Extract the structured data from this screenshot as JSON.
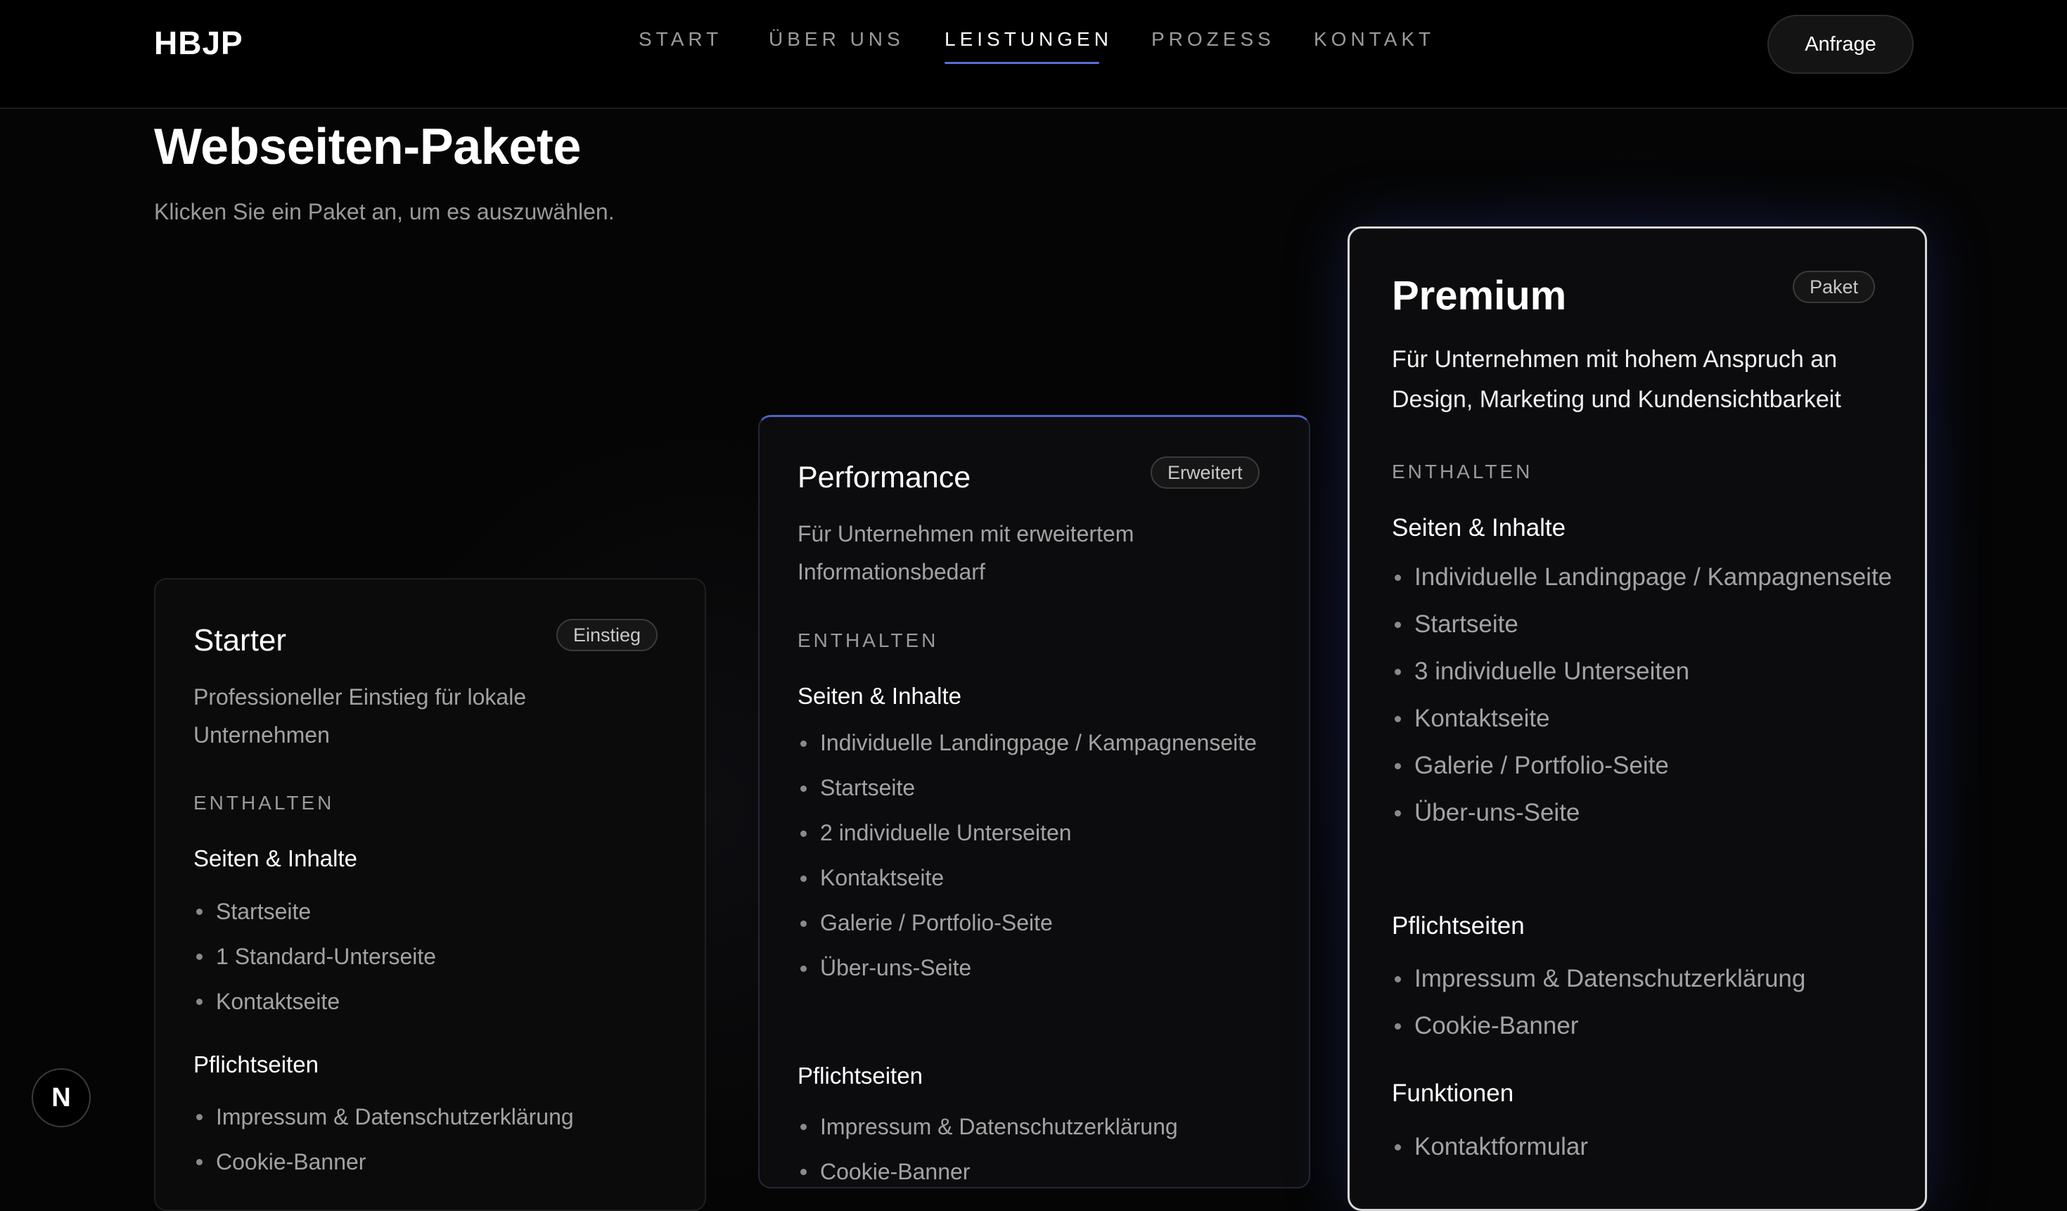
{
  "header": {
    "logo": "HBJP",
    "nav": [
      {
        "label": "START",
        "active": false
      },
      {
        "label": "ÜBER UNS",
        "active": false
      },
      {
        "label": "LEISTUNGEN",
        "active": true
      },
      {
        "label": "PROZESS",
        "active": false
      },
      {
        "label": "KONTAKT",
        "active": false
      }
    ],
    "cta_label": "Anfrage"
  },
  "main": {
    "title": "Webseiten-Pakete",
    "subtitle": "Klicken Sie ein Paket an, um es auszuwählen."
  },
  "packages": [
    {
      "name": "Starter",
      "badge": "Einstieg",
      "description": "Professioneller Einstieg für lokale Unternehmen",
      "section_label": "ENTHALTEN",
      "groups": [
        {
          "title": "Seiten & Inhalte",
          "items": [
            "Startseite",
            "1 Standard-Unterseite",
            "Kontaktseite"
          ]
        },
        {
          "title": "Pflichtseiten",
          "items": [
            "Impressum & Datenschutzerklärung",
            "Cookie-Banner"
          ]
        }
      ]
    },
    {
      "name": "Performance",
      "badge": "Erweitert",
      "description": "Für Unternehmen mit erweitertem Informationsbedarf",
      "section_label": "ENTHALTEN",
      "groups": [
        {
          "title": "Seiten & Inhalte",
          "items": [
            "Individuelle Landingpage / Kampagnenseite",
            "Startseite",
            "2 individuelle Unterseiten",
            "Kontaktseite",
            "Galerie / Portfolio-Seite",
            "Über-uns-Seite"
          ]
        },
        {
          "title": "Pflichtseiten",
          "items": [
            "Impressum & Datenschutzerklärung",
            "Cookie-Banner"
          ]
        }
      ]
    },
    {
      "name": "Premium",
      "badge": "Paket",
      "description": "Für Unternehmen mit hohem Anspruch an Design, Marketing und Kundensichtbarkeit",
      "section_label": "ENTHALTEN",
      "groups": [
        {
          "title": "Seiten & Inhalte",
          "items": [
            "Individuelle Landingpage / Kampagnenseite",
            "Startseite",
            "3 individuelle Unterseiten",
            "Kontaktseite",
            "Galerie / Portfolio-Seite",
            "Über-uns-Seite"
          ]
        },
        {
          "title": "Pflichtseiten",
          "items": [
            "Impressum & Datenschutzerklärung",
            "Cookie-Banner"
          ]
        },
        {
          "title": "Funktionen",
          "items": [
            "Kontaktformular"
          ]
        }
      ]
    }
  ],
  "dev_badge": "N",
  "colors": {
    "accent": "#5c6fd6",
    "background": "#050505",
    "selected_border": "#d8d8d8"
  }
}
